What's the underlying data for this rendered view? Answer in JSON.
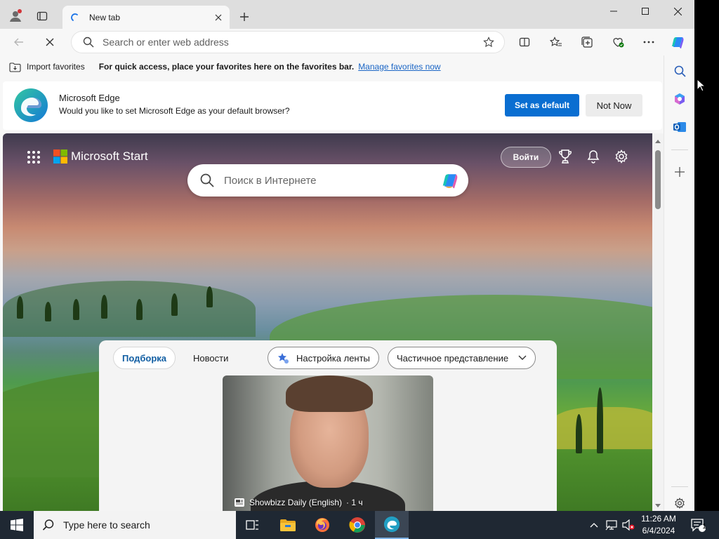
{
  "browser": {
    "tab_title": "New tab",
    "address_placeholder": "Search or enter web address"
  },
  "favorites_bar": {
    "import_label": "Import favorites",
    "message": "For quick access, place your favorites here on the favorites bar.",
    "manage_link": "Manage favorites now"
  },
  "banner": {
    "title": "Microsoft Edge",
    "subtitle": "Would you like to set Microsoft Edge as your default browser?",
    "primary_button": "Set as default",
    "secondary_button": "Not Now"
  },
  "start_page": {
    "brand": "Microsoft Start",
    "sign_in": "Войти",
    "search_placeholder": "Поиск в Интернете",
    "tabs": [
      {
        "label": "Подборка",
        "active": true
      },
      {
        "label": "Новости",
        "active": false
      }
    ],
    "personalize_label": "Настройка ленты",
    "layout_label": "Частичное представление",
    "card": {
      "source": "Showbizz Daily (English)",
      "age": "· 1 ч"
    }
  },
  "taskbar": {
    "search_placeholder": "Type here to search",
    "time": "11:26 AM",
    "date": "6/4/2024",
    "notification_count": "1"
  },
  "colors": {
    "accent": "#0a6ed1",
    "link": "#1a65c5",
    "taskbar": "#1f2833"
  }
}
